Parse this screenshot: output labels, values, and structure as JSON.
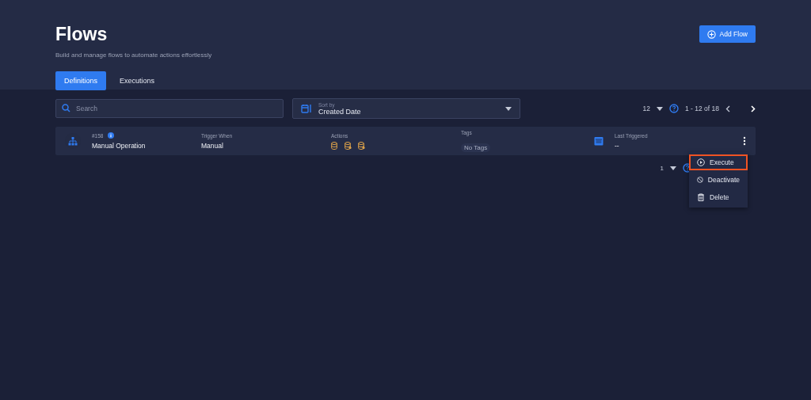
{
  "header": {
    "title": "Flows",
    "subtitle": "Build and manage flows to automate actions effortlessly",
    "add_button": "Add Flow"
  },
  "tabs": [
    {
      "label": "Definitions",
      "selected": true
    },
    {
      "label": "Executions",
      "selected": false
    }
  ],
  "search": {
    "placeholder": "Search"
  },
  "sort": {
    "label": "Sort by",
    "value": "Created Date"
  },
  "pagination": {
    "page_size": "12",
    "range": "1 - 12 of 18"
  },
  "flows": [
    {
      "id": "#158",
      "name": "Manual Operation",
      "trigger_label": "Trigger When",
      "trigger": "Manual",
      "actions_label": "Actions",
      "tags_label": "Tags",
      "tags": "No Tags",
      "last_label": "Last Triggered",
      "last": "--"
    }
  ],
  "bottom_pagination": {
    "page": "1"
  },
  "menu": [
    {
      "label": "Execute",
      "kind": "execute",
      "highlighted": true
    },
    {
      "label": "Deactivate",
      "kind": "deactivate",
      "highlighted": false
    },
    {
      "label": "Delete",
      "kind": "delete",
      "highlighted": false
    }
  ]
}
